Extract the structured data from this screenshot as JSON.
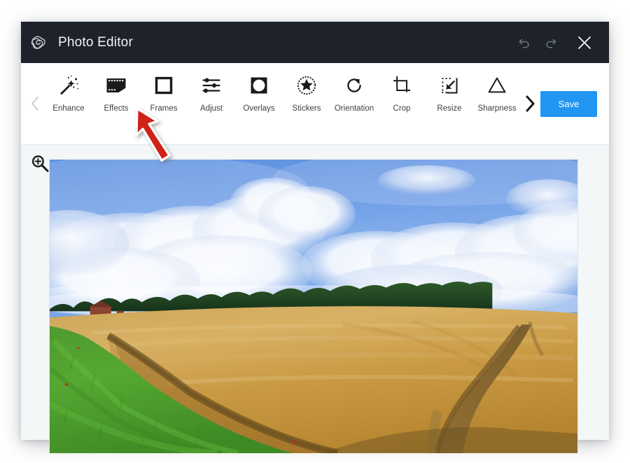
{
  "window": {
    "title": "Photo Editor",
    "logo_icon": "creative-cloud-logo-icon"
  },
  "titlebar_actions": [
    {
      "name": "undo-button",
      "icon": "undo-arrow-icon",
      "label": "Undo",
      "enabled": false
    },
    {
      "name": "redo-button",
      "icon": "redo-arrow-icon",
      "label": "Redo",
      "enabled": false
    },
    {
      "name": "close-button",
      "icon": "close-x-icon",
      "label": "Close",
      "enabled": true
    }
  ],
  "toolbar": {
    "prev_label": "Previous tools",
    "prev_icon": "chevron-left-icon",
    "next_label": "More tools",
    "next_icon": "chevron-right-icon",
    "save_label": "Save",
    "save_color": "#2196f3",
    "tools": [
      {
        "label": "Enhance",
        "icon": "magic-wand-icon"
      },
      {
        "label": "Effects",
        "icon": "film-strip-icon"
      },
      {
        "label": "Frames",
        "icon": "square-frame-icon"
      },
      {
        "label": "Adjust",
        "icon": "sliders-icon"
      },
      {
        "label": "Overlays",
        "icon": "circle-in-square-icon"
      },
      {
        "label": "Stickers",
        "icon": "star-badge-icon"
      },
      {
        "label": "Orientation",
        "icon": "rotate-clockwise-icon"
      },
      {
        "label": "Crop",
        "icon": "crop-icon"
      },
      {
        "label": "Resize",
        "icon": "resize-arrow-icon"
      },
      {
        "label": "Sharpness",
        "icon": "triangle-icon"
      }
    ]
  },
  "canvas": {
    "zoom_icon": "zoom-in-magnifier-icon",
    "zoom_label": "Zoom in",
    "photo_alt": "Wheat field with green grass verge under blue sky with cumulus clouds",
    "background_color": "#f3f7f8"
  },
  "annotation": {
    "name": "red-arrow-pointer",
    "points_to": "Effects",
    "color": "#d32017"
  }
}
